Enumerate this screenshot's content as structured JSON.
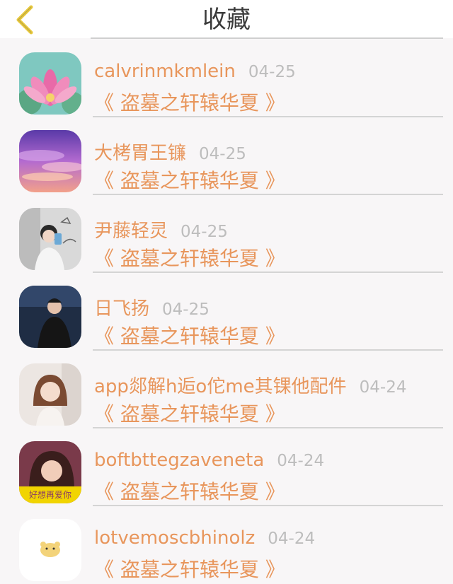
{
  "header": {
    "title": "收藏",
    "back_icon": "chevron-left-icon",
    "accent_color": "#e8c93c"
  },
  "items": [
    {
      "name": "calvrinmkmlein",
      "date": "04-25",
      "book": "《 盗墓之轩辕华夏 》",
      "avatar": "lotus-flower"
    },
    {
      "name": "大栲胃王镰",
      "date": "04-25",
      "book": "《 盗墓之轩辕华夏 》",
      "avatar": "purple-sky"
    },
    {
      "name": "尹藤轻灵",
      "date": "04-25",
      "book": "《 盗墓之轩辕华夏 》",
      "avatar": "girl-selfie"
    },
    {
      "name": "日飞扬",
      "date": "04-25",
      "book": "《 盗墓之轩辕华夏 》",
      "avatar": "man-dark-coat"
    },
    {
      "name": "app郯解h逅o佗me其锞他配件",
      "date": "04-24",
      "book": "《 盗墓之轩辕华夏 》",
      "avatar": "girl-portrait"
    },
    {
      "name": "boftbttegzaveneta",
      "date": "04-24",
      "book": "《 盗墓之轩辕华夏 》",
      "avatar": "girl-yellow-banner",
      "avatar_caption": "好想再爱你"
    },
    {
      "name": "lotvemoscbhinolz",
      "date": "04-24",
      "book": "《 盗墓之轩辕华夏 》",
      "avatar": "cartoon-hamster"
    }
  ],
  "colors": {
    "name": "#e8965c",
    "date": "#bdbdbd",
    "background": "#f8f6f7"
  }
}
